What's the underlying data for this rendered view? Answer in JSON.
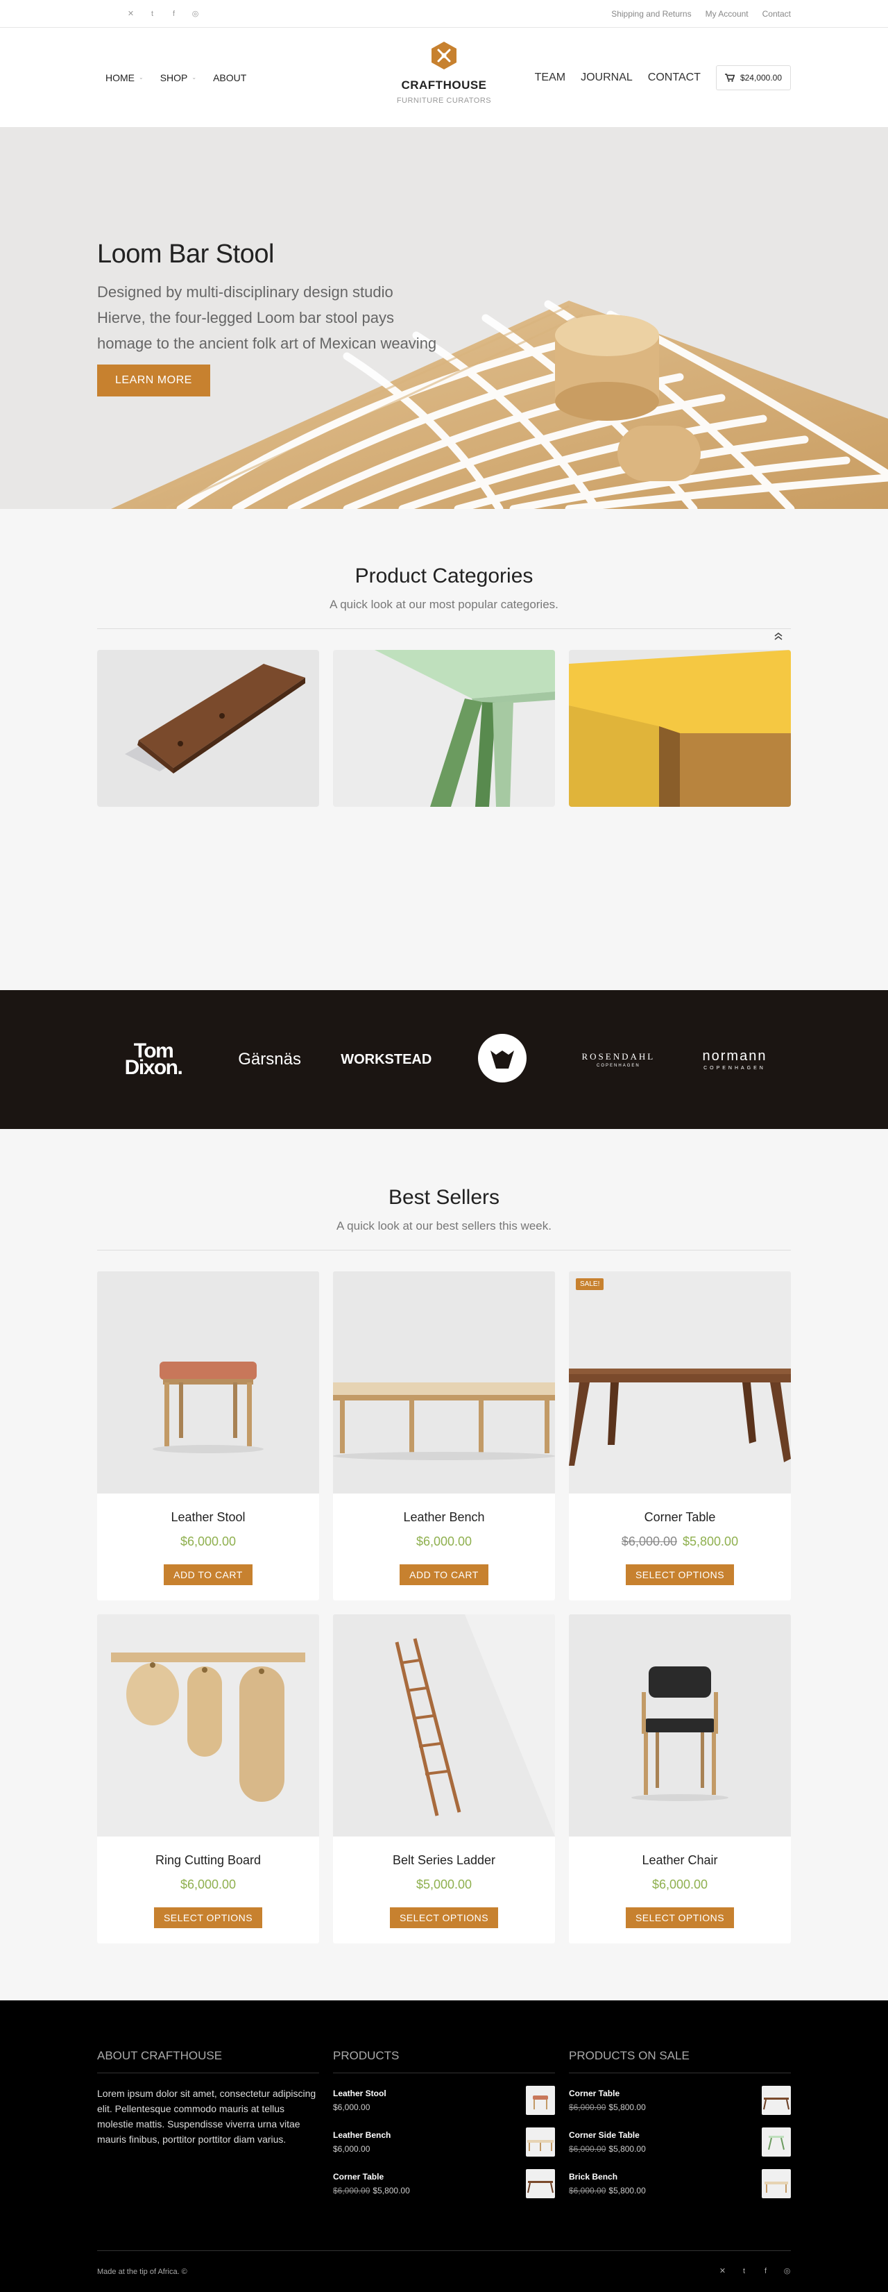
{
  "topbar": {
    "social": [
      "apple-icon",
      "twitter-icon",
      "tumblr-icon",
      "facebook-icon",
      "dribbble-icon"
    ],
    "links": [
      "Shipping and Returns",
      "My Account",
      "Contact"
    ]
  },
  "header": {
    "nav_left": [
      {
        "label": "HOME",
        "has_dropdown": true
      },
      {
        "label": "SHOP",
        "has_dropdown": true
      },
      {
        "label": "ABOUT",
        "has_dropdown": false
      }
    ],
    "brand": "CRAFTHOUSE",
    "tagline": "FURNITURE CURATORS",
    "nav_right": [
      "TEAM",
      "JOURNAL",
      "CONTACT"
    ],
    "cart_total": "$24,000.00"
  },
  "hero": {
    "title": "Loom Bar Stool",
    "text": "Designed by multi-disciplinary design studio Hierve, the four-legged Loom bar stool pays homage to the ancient folk art of Mexican weaving",
    "button": "LEARN MORE"
  },
  "categories": {
    "title": "Product Categories",
    "subtitle": "A quick look at our most popular categories."
  },
  "brands": [
    "Tom Dixon.",
    "Gärsnäs",
    "WORKSTEAD",
    "Herman Miller",
    "ROSENDAHL",
    "normann"
  ],
  "brand_subs": {
    "rosendahl": "COPENHAGEN",
    "normann": "COPENHAGEN"
  },
  "best": {
    "title": "Best Sellers",
    "subtitle": "A quick look at our best sellers this week.",
    "products": [
      {
        "name": "Leather Stool",
        "price": "$6,000.00",
        "old_price": "",
        "button": "ADD TO CART",
        "sale": ""
      },
      {
        "name": "Leather Bench",
        "price": "$6,000.00",
        "old_price": "",
        "button": "ADD TO CART",
        "sale": ""
      },
      {
        "name": "Corner Table",
        "price": "$5,800.00",
        "old_price": "$6,000.00",
        "button": "SELECT OPTIONS",
        "sale": "SALE!"
      },
      {
        "name": "Ring Cutting Board",
        "price": "$6,000.00",
        "old_price": "",
        "button": "SELECT OPTIONS",
        "sale": ""
      },
      {
        "name": "Belt Series Ladder",
        "price": "$5,000.00",
        "old_price": "",
        "button": "SELECT OPTIONS",
        "sale": ""
      },
      {
        "name": "Leather Chair",
        "price": "$6,000.00",
        "old_price": "",
        "button": "SELECT OPTIONS",
        "sale": ""
      }
    ]
  },
  "footer": {
    "about_title": "ABOUT CRAFTHOUSE",
    "about_text": "Lorem ipsum dolor sit amet, consectetur adipiscing elit. Pellentesque commodo mauris at tellus molestie mattis. Suspendisse viverra urna vitae mauris finibus, porttitor porttitor diam varius.",
    "products_title": "PRODUCTS",
    "products": [
      {
        "name": "Leather Stool",
        "price": "$6,000.00",
        "old_price": ""
      },
      {
        "name": "Leather Bench",
        "price": "$6,000.00",
        "old_price": ""
      },
      {
        "name": "Corner Table",
        "price": "$5,800.00",
        "old_price": "$6,000.00"
      }
    ],
    "sale_title": "PRODUCTS ON SALE",
    "sale": [
      {
        "name": "Corner Table",
        "price": "$5,800.00",
        "old_price": "$6,000.00"
      },
      {
        "name": "Corner Side Table",
        "price": "$5,800.00",
        "old_price": "$6,000.00"
      },
      {
        "name": "Brick Bench",
        "price": "$5,800.00",
        "old_price": "$6,000.00"
      }
    ],
    "copyright": "Made at the tip of Africa. ©",
    "social": [
      "apple-icon",
      "twitter-icon",
      "tumblr-icon",
      "facebook-icon",
      "dribbble-icon"
    ]
  },
  "colors": {
    "accent": "#c7812f",
    "price_green": "#8fb04f",
    "brands_bg": "#1b1512",
    "footer_bg": "#000000"
  }
}
